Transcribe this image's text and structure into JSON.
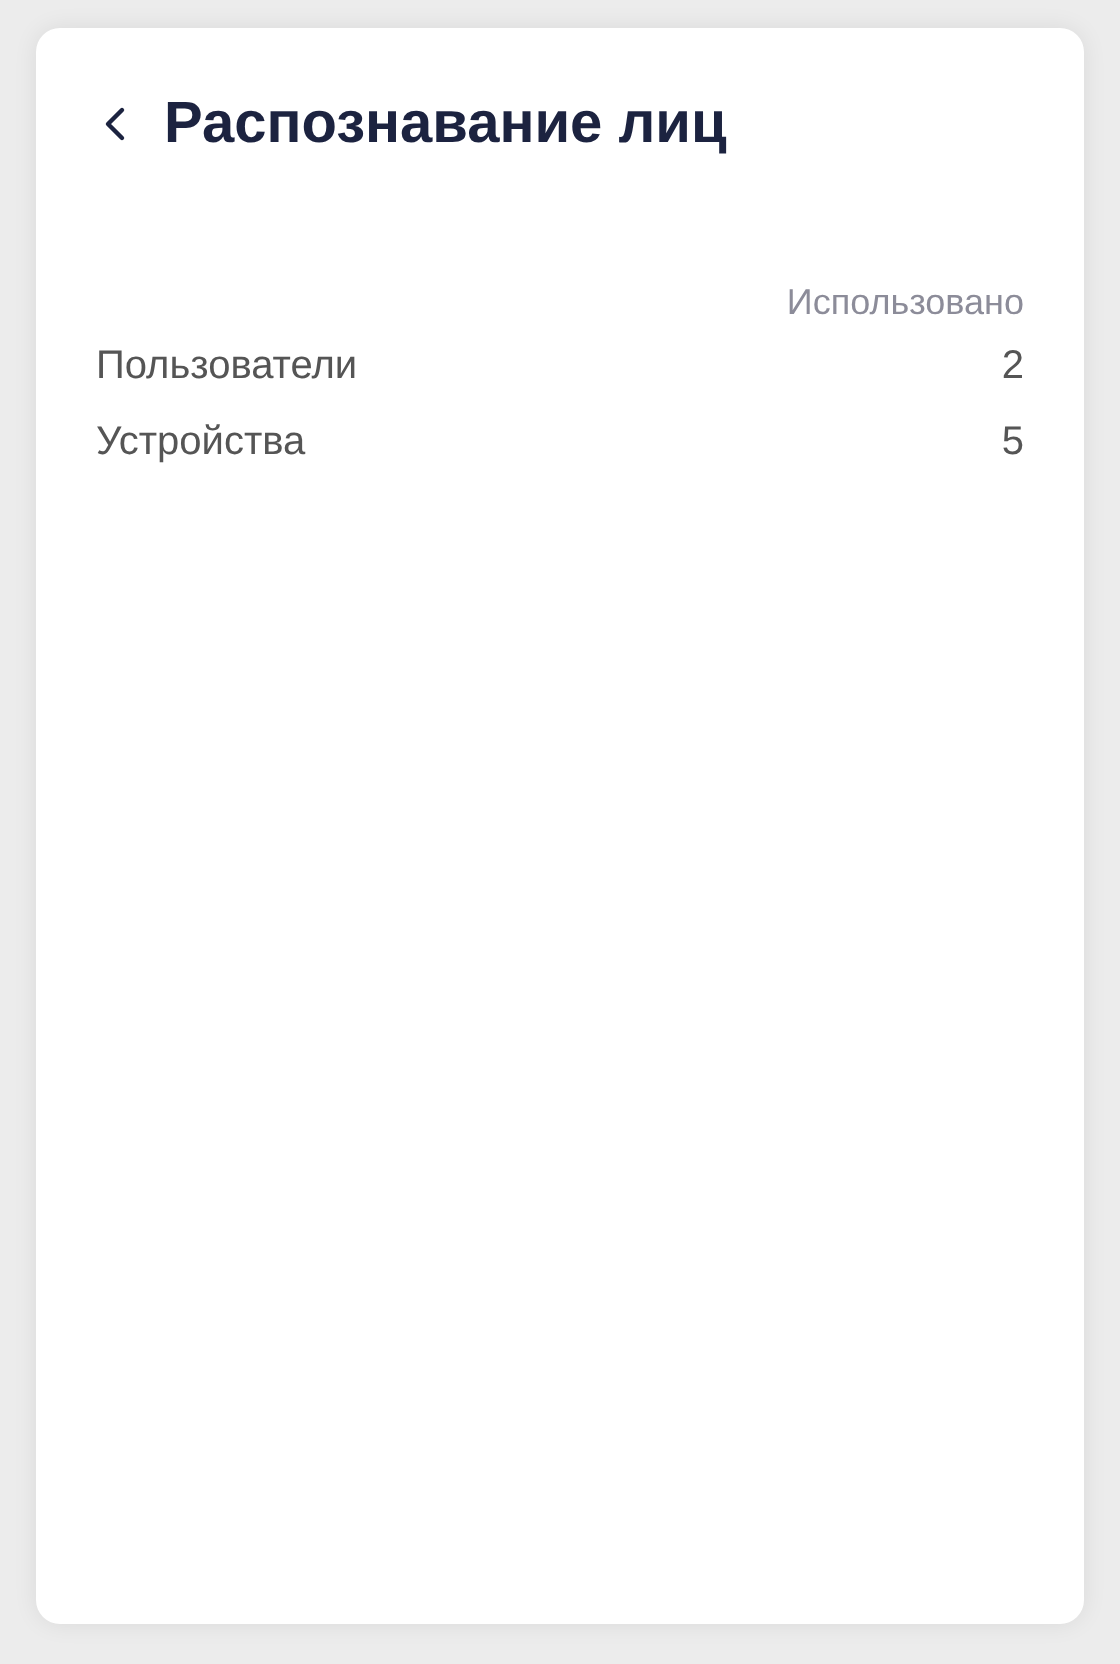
{
  "header": {
    "title": "Распознавание лиц"
  },
  "table": {
    "columns": [
      "Использовано"
    ],
    "rows": [
      {
        "label": "Пользователи",
        "value": "2"
      },
      {
        "label": "Устройства",
        "value": "5"
      }
    ]
  }
}
